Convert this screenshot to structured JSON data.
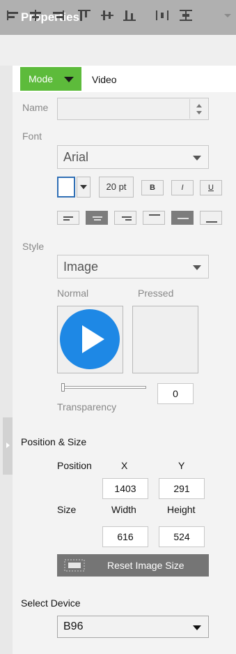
{
  "panel": {
    "title": "Properties"
  },
  "toolbar": {
    "icons": [
      "align-left-icon",
      "align-center-icon",
      "align-right-icon",
      "align-top-icon",
      "align-middle-icon",
      "align-bottom-icon",
      "distribute-horizontal-icon",
      "distribute-vertical-icon",
      "toolbar-more-icon"
    ]
  },
  "tabs": {
    "mode_label": "Mode",
    "video_label": "Video"
  },
  "name": {
    "label": "Name",
    "value": ""
  },
  "font": {
    "label": "Font",
    "family": "Arial",
    "size": "20 pt",
    "bold_label": "B",
    "italic_label": "I",
    "underline_label": "U",
    "color": "#ffffff"
  },
  "style": {
    "label": "Style",
    "value": "Image",
    "normal_label": "Normal",
    "pressed_label": "Pressed",
    "transparency_label": "Transparency",
    "transparency_value": "0",
    "play_color": "#1e88e5"
  },
  "position_size": {
    "section_label": "Position & Size",
    "position_label": "Position",
    "x_label": "X",
    "y_label": "Y",
    "x_value": "1403",
    "y_value": "291",
    "size_label": "Size",
    "width_label": "Width",
    "height_label": "Height",
    "width_value": "616",
    "height_value": "524",
    "reset_label": "Reset Image Size"
  },
  "device": {
    "label": "Select Device",
    "value": "B96"
  },
  "colors": {
    "accent_green": "#5dbb3b",
    "header_grey": "#b0b0b0",
    "button_dark": "#757575"
  }
}
